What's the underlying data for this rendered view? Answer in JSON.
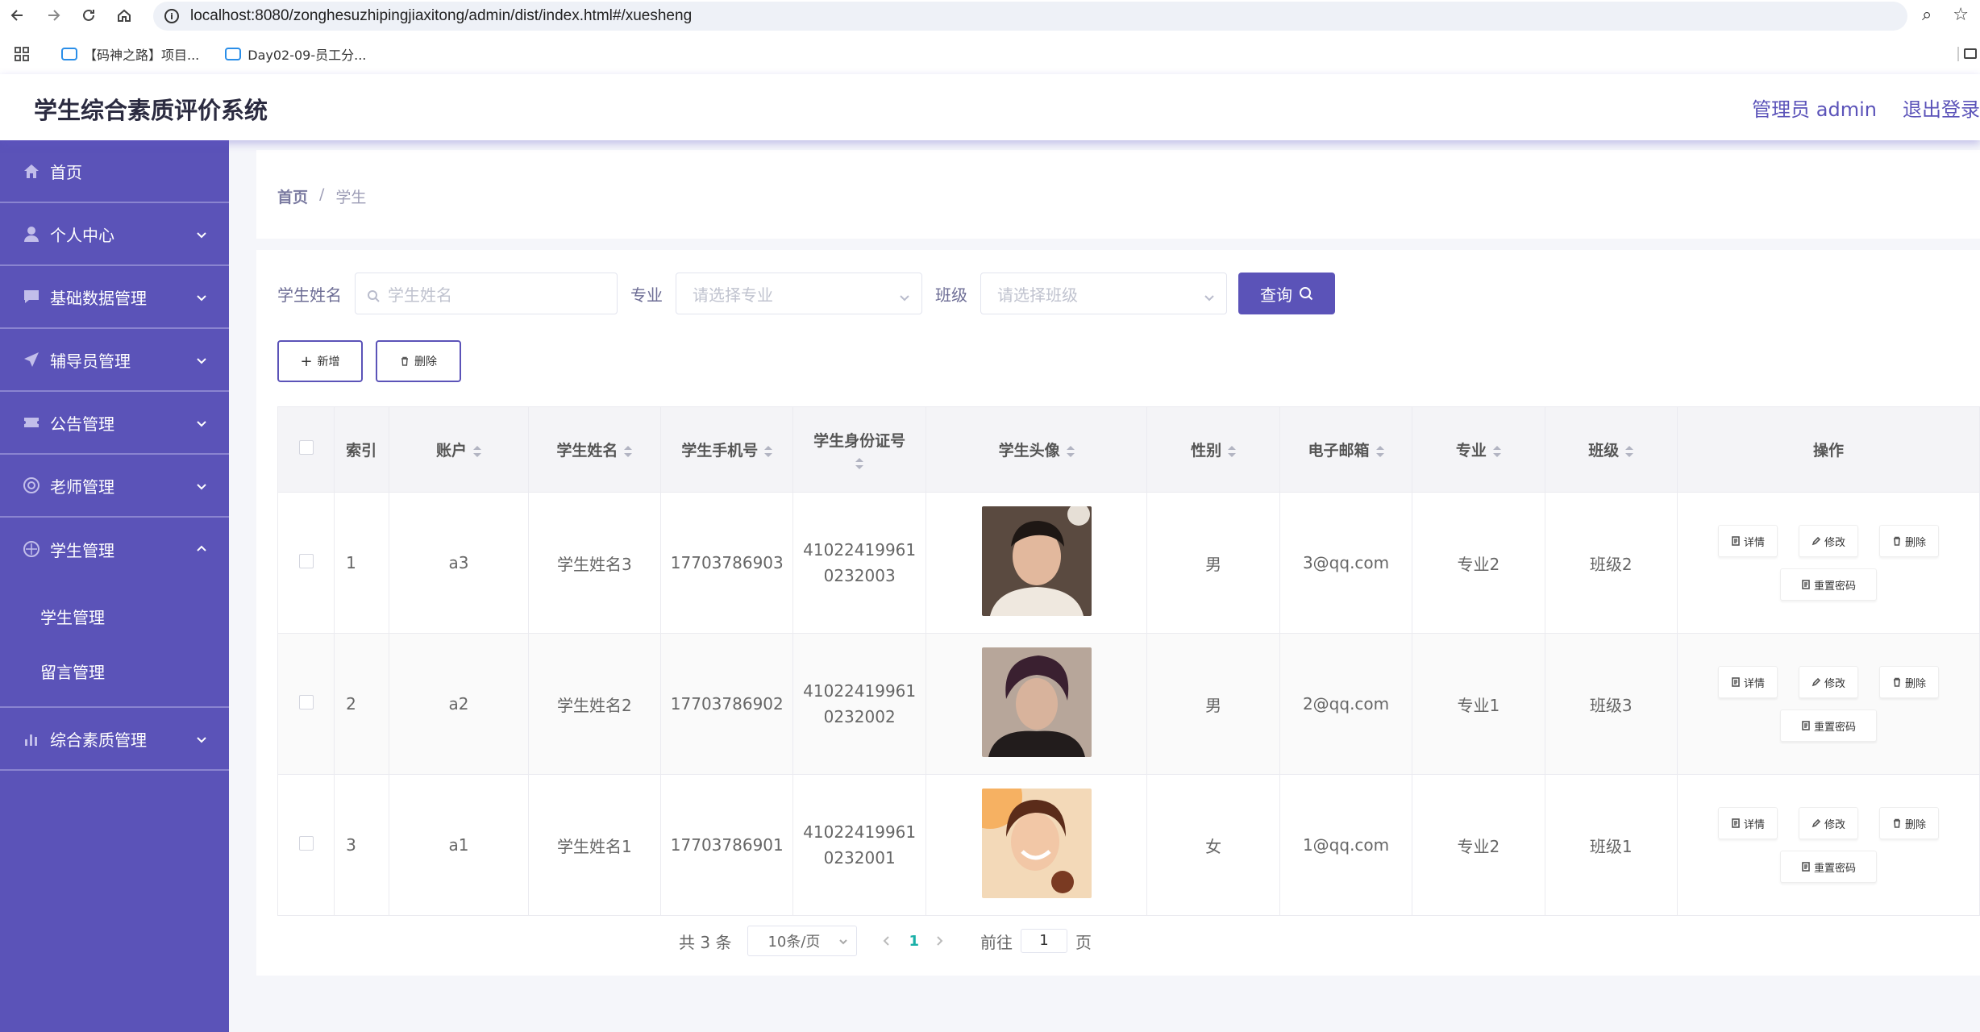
{
  "browser": {
    "url": "localhost:8080/zonghesuzhipingjiaxitong/admin/dist/index.html#/xuesheng",
    "bookmarks": [
      "【码神之路】项目...",
      "Day02-09-员工分..."
    ]
  },
  "header": {
    "title": "学生综合素质评价系统",
    "user": "管理员 admin",
    "logout": "退出登录"
  },
  "sidebar": {
    "items": [
      {
        "label": "首页",
        "icon": "home-icon"
      },
      {
        "label": "个人中心",
        "icon": "person-icon"
      },
      {
        "label": "基础数据管理",
        "icon": "chat-icon"
      },
      {
        "label": "辅导员管理",
        "icon": "send-icon"
      },
      {
        "label": "公告管理",
        "icon": "ticket-icon"
      },
      {
        "label": "老师管理",
        "icon": "ring-icon"
      },
      {
        "label": "学生管理",
        "icon": "compass-icon"
      },
      {
        "label": "综合素质管理",
        "icon": "bar-chart-icon"
      }
    ],
    "submenu": [
      "学生管理",
      "留言管理"
    ]
  },
  "breadcrumb": {
    "home": "首页",
    "sep": "/",
    "current": "学生"
  },
  "search": {
    "name_label": "学生姓名",
    "name_placeholder": "学生姓名",
    "major_label": "专业",
    "major_placeholder": "请选择专业",
    "class_label": "班级",
    "class_placeholder": "请选择班级",
    "query": "查询"
  },
  "actions": {
    "add": "新增",
    "delete": "删除"
  },
  "table": {
    "columns": [
      "索引",
      "账户",
      "学生姓名",
      "学生手机号",
      "学生身份证号",
      "学生头像",
      "性别",
      "电子邮箱",
      "专业",
      "班级",
      "操作"
    ],
    "rows": [
      {
        "index": "1",
        "account": "a3",
        "name": "学生姓名3",
        "phone": "17703786903",
        "id1": "41022419961",
        "id2": "0232003",
        "gender": "男",
        "email": "3@qq.com",
        "major": "专业2",
        "class": "班级2"
      },
      {
        "index": "2",
        "account": "a2",
        "name": "学生姓名2",
        "phone": "17703786902",
        "id1": "41022419961",
        "id2": "0232002",
        "gender": "男",
        "email": "2@qq.com",
        "major": "专业1",
        "class": "班级3"
      },
      {
        "index": "3",
        "account": "a1",
        "name": "学生姓名1",
        "phone": "17703786901",
        "id1": "41022419961",
        "id2": "0232001",
        "gender": "女",
        "email": "1@qq.com",
        "major": "专业2",
        "class": "班级1"
      }
    ],
    "ops": {
      "detail": "详情",
      "edit": "修改",
      "delete": "删除",
      "reset": "重置密码"
    }
  },
  "pagination": {
    "total": "共 3 条",
    "page_size": "10条/页",
    "current": "1",
    "goto_label": "前往",
    "goto_value": "1",
    "page_suffix": "页"
  },
  "colors": {
    "primary": "#5b53b8",
    "accent": "#1ab0a8"
  }
}
